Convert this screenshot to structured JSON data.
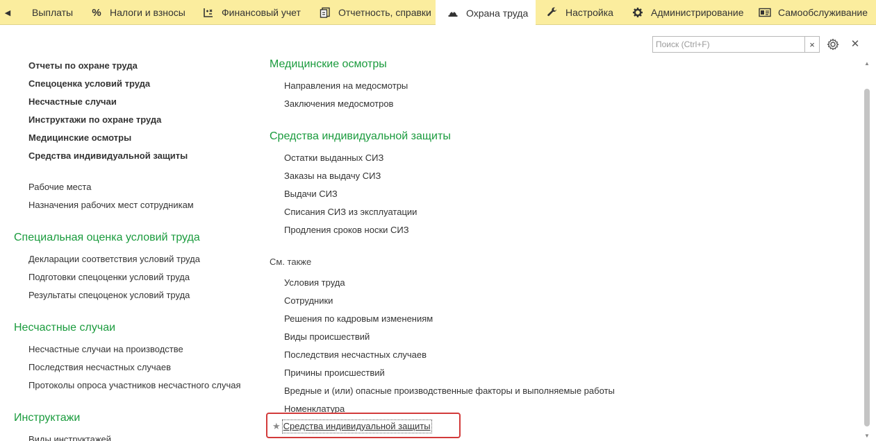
{
  "tabs": [
    {
      "label": "Выплаты",
      "icon": "back-arrow-icon"
    },
    {
      "label": "Налоги и взносы",
      "icon": "percent-icon"
    },
    {
      "label": "Финансовый учет",
      "icon": "ledger-icon"
    },
    {
      "label": "Отчетность, справки",
      "icon": "reports-icon"
    },
    {
      "label": "Охрана труда",
      "icon": "hardhat-icon",
      "active": true
    },
    {
      "label": "Настройка",
      "icon": "wrench-icon"
    },
    {
      "label": "Администрирование",
      "icon": "gear-icon"
    },
    {
      "label": "Самообслуживание",
      "icon": "id-card-icon"
    }
  ],
  "search": {
    "placeholder": "Поиск (Ctrl+F)",
    "value": ""
  },
  "left_column": {
    "bold_items": [
      "Отчеты по охране труда",
      "Спецоценка условий труда",
      "Несчастные случаи",
      "Инструктажи по охране труда",
      "Медицинские осмотры",
      "Средства индивидуальной защиты"
    ],
    "plain_items": [
      "Рабочие места",
      "Назначения рабочих мест сотрудникам"
    ],
    "sections": [
      {
        "title": "Специальная оценка условий труда",
        "items": [
          "Декларации соответствия условий труда",
          "Подготовки спецоценки условий труда",
          "Результаты спецоценок условий труда"
        ]
      },
      {
        "title": "Несчастные случаи",
        "items": [
          "Несчастные случаи на производстве",
          "Последствия несчастных случаев",
          "Протоколы опроса участников несчастного случая"
        ]
      },
      {
        "title": "Инструктажи",
        "items": [
          "Виды инструктажей"
        ]
      }
    ]
  },
  "right_column": {
    "sections": [
      {
        "title": "Медицинские осмотры",
        "items": [
          "Направления на медосмотры",
          "Заключения медосмотров"
        ]
      },
      {
        "title": "Средства индивидуальной защиты",
        "items": [
          "Остатки выданных СИЗ",
          "Заказы на выдачу СИЗ",
          "Выдачи СИЗ",
          "Списания СИЗ из эксплуатации",
          "Продления сроков носки СИЗ"
        ]
      }
    ],
    "see_also": {
      "title": "См. также",
      "items": [
        "Условия труда",
        "Сотрудники",
        "Решения по кадровым изменениям",
        "Виды происшествий",
        "Последствия несчастных случаев",
        "Причины происшествий",
        "Вредные и (или) опасные производственные факторы и выполняемые работы",
        "Номенклатура"
      ],
      "favorite_item": "Средства индивидуальной защиты"
    }
  },
  "colors": {
    "tabbar_bg": "#fbed9e",
    "heading_green": "#1a9b3d",
    "highlight_red": "#d23a3a"
  }
}
